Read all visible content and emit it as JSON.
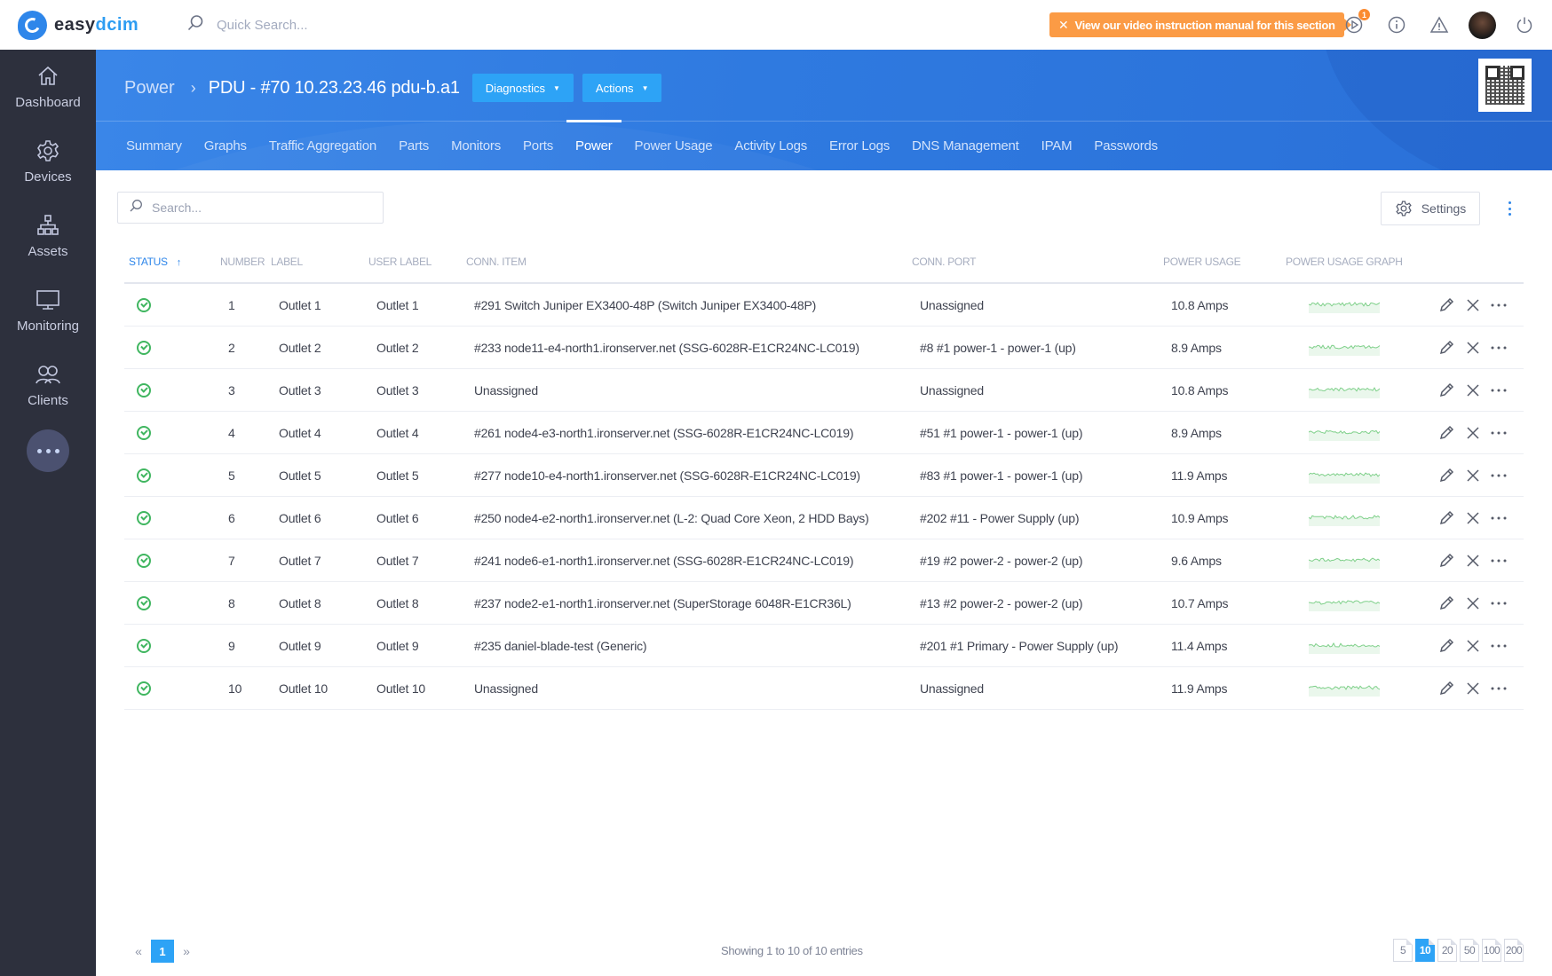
{
  "app": {
    "brand_prefix": "easy",
    "brand_suffix": "dcim"
  },
  "topbar": {
    "search_placeholder": "Quick Search...",
    "banner_text": "View our video instruction manual for this section",
    "video_badge_count": "1",
    "icons": [
      "search-icon",
      "video-play-icon",
      "info-icon",
      "warning-icon",
      "avatar",
      "power-icon"
    ]
  },
  "sidebar": {
    "items": [
      {
        "label": "Dashboard",
        "icon": "home-icon"
      },
      {
        "label": "Devices",
        "icon": "gear-icon"
      },
      {
        "label": "Assets",
        "icon": "hierarchy-icon"
      },
      {
        "label": "Monitoring",
        "icon": "monitor-icon"
      },
      {
        "label": "Clients",
        "icon": "users-icon"
      }
    ],
    "more_icon": "ellipsis-icon"
  },
  "header": {
    "breadcrumb_parent": "Power",
    "breadcrumb_current": "PDU - #70 10.23.23.46 pdu-b.a1",
    "diagnostics_label": "Diagnostics",
    "actions_label": "Actions",
    "tabs": [
      {
        "label": "Summary",
        "active": false
      },
      {
        "label": "Graphs",
        "active": false
      },
      {
        "label": "Traffic Aggregation",
        "active": false
      },
      {
        "label": "Parts",
        "active": false
      },
      {
        "label": "Monitors",
        "active": false
      },
      {
        "label": "Ports",
        "active": false
      },
      {
        "label": "Power",
        "active": true
      },
      {
        "label": "Power Usage",
        "active": false
      },
      {
        "label": "Activity Logs",
        "active": false
      },
      {
        "label": "Error Logs",
        "active": false
      },
      {
        "label": "DNS Management",
        "active": false
      },
      {
        "label": "IPAM",
        "active": false
      },
      {
        "label": "Passwords",
        "active": false
      }
    ]
  },
  "toolbar": {
    "search_placeholder": "Search...",
    "settings_label": "Settings"
  },
  "table": {
    "columns": {
      "status": "Status",
      "number": "Number",
      "label": "Label",
      "user_label": "User Label",
      "conn_item": "Conn. Item",
      "conn_port": "Conn. Port",
      "power_usage": "Power Usage",
      "power_usage_graph": "Power Usage Graph"
    },
    "sort": {
      "column": "status",
      "direction": "asc"
    },
    "rows": [
      {
        "status": "ok",
        "number": "1",
        "label": "Outlet 1",
        "user_label": "Outlet 1",
        "conn_item": "#291 Switch Juniper EX3400-48P (Switch Juniper EX3400-48P)",
        "conn_port": "Unassigned",
        "power_usage": "10.8 Amps"
      },
      {
        "status": "ok",
        "number": "2",
        "label": "Outlet 2",
        "user_label": "Outlet 2",
        "conn_item": "#233 node11-e4-north1.ironserver.net (SSG-6028R-E1CR24NC-LC019)",
        "conn_port": "#8 #1 power-1 - power-1 (up)",
        "power_usage": "8.9 Amps"
      },
      {
        "status": "ok",
        "number": "3",
        "label": "Outlet 3",
        "user_label": "Outlet 3",
        "conn_item": "Unassigned",
        "conn_port": "Unassigned",
        "power_usage": "10.8 Amps"
      },
      {
        "status": "ok",
        "number": "4",
        "label": "Outlet 4",
        "user_label": "Outlet 4",
        "conn_item": "#261 node4-e3-north1.ironserver.net (SSG-6028R-E1CR24NC-LC019)",
        "conn_port": "#51 #1 power-1 - power-1 (up)",
        "power_usage": "8.9 Amps"
      },
      {
        "status": "ok",
        "number": "5",
        "label": "Outlet 5",
        "user_label": "Outlet 5",
        "conn_item": "#277 node10-e4-north1.ironserver.net (SSG-6028R-E1CR24NC-LC019)",
        "conn_port": "#83 #1 power-1 - power-1 (up)",
        "power_usage": "11.9 Amps"
      },
      {
        "status": "ok",
        "number": "6",
        "label": "Outlet 6",
        "user_label": "Outlet 6",
        "conn_item": "#250 node4-e2-north1.ironserver.net (L-2: Quad Core Xeon, 2 HDD Bays)",
        "conn_port": "#202 #11 - Power Supply (up)",
        "power_usage": "10.9 Amps"
      },
      {
        "status": "ok",
        "number": "7",
        "label": "Outlet 7",
        "user_label": "Outlet 7",
        "conn_item": "#241 node6-e1-north1.ironserver.net (SSG-6028R-E1CR24NC-LC019)",
        "conn_port": "#19 #2 power-2 - power-2 (up)",
        "power_usage": "9.6 Amps"
      },
      {
        "status": "ok",
        "number": "8",
        "label": "Outlet 8",
        "user_label": "Outlet 8",
        "conn_item": "#237 node2-e1-north1.ironserver.net (SuperStorage 6048R-E1CR36L)",
        "conn_port": "#13 #2 power-2 - power-2 (up)",
        "power_usage": "10.7 Amps"
      },
      {
        "status": "ok",
        "number": "9",
        "label": "Outlet 9",
        "user_label": "Outlet 9",
        "conn_item": "#235 daniel-blade-test (Generic)",
        "conn_port": "#201 #1 Primary - Power Supply (up)",
        "power_usage": "11.4 Amps"
      },
      {
        "status": "ok",
        "number": "10",
        "label": "Outlet 10",
        "user_label": "Outlet 10",
        "conn_item": "Unassigned",
        "conn_port": "Unassigned",
        "power_usage": "11.9 Amps"
      }
    ],
    "row_actions": [
      "edit-icon",
      "delete-icon",
      "more-icon"
    ]
  },
  "footer": {
    "current_page": "1",
    "showing_text": "Showing 1 to 10 of 10 entries",
    "page_sizes": [
      "5",
      "10",
      "20",
      "50",
      "100",
      "200"
    ],
    "active_page_size": "10"
  },
  "colors": {
    "accent": "#2da3f6",
    "header_blue": "#2f7ae0",
    "sidebar_bg": "#2d303d",
    "banner_orange": "#fb9b45",
    "status_ok": "#40b660",
    "sparkline": "#7fd08a"
  }
}
